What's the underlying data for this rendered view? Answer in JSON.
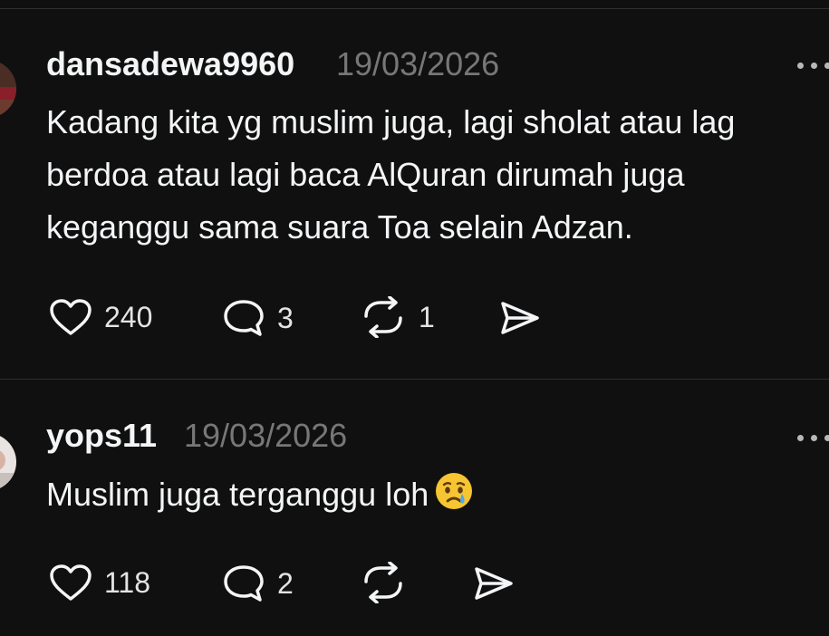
{
  "posts": [
    {
      "username": "dansadewa9960",
      "date": "19/03/2026",
      "lines": [
        "Kadang kita yg muslim juga, lagi sholat atau lag",
        "berdoa atau lagi baca AlQuran dirumah juga",
        "keganggu sama suara Toa selain Adzan."
      ],
      "likes": "240",
      "replies": "3",
      "reposts": "1"
    },
    {
      "username": "yops11",
      "date": "19/03/2026",
      "lines": [
        "Muslim juga terganggu loh"
      ],
      "emoji": "crying-face",
      "likes": "118",
      "replies": "2"
    }
  ],
  "icons": {
    "like": "heart-icon",
    "reply": "comment-icon",
    "repost": "repost-icon",
    "share": "send-icon",
    "menu": "more-options-icon"
  },
  "colors": {
    "background": "#101010",
    "text": "#f3f5f7",
    "muted": "#777777",
    "divider": "#2f2f2f"
  }
}
